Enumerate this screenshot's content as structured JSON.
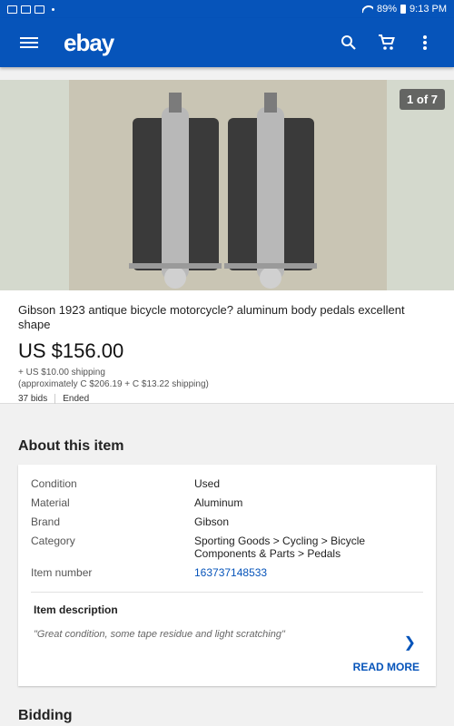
{
  "status": {
    "battery": "89%",
    "time": "9:13 PM"
  },
  "appbar": {
    "logo": "ebay"
  },
  "photo": {
    "counter": "1 of 7"
  },
  "listing": {
    "title": "Gibson 1923 antique bicycle motorcycle?  aluminum body pedals excellent shape",
    "price": "US $156.00",
    "shipping": "+ US $10.00 shipping",
    "approx": "(approximately C $206.19 + C $13.22 shipping)",
    "bids": "37 bids",
    "status": "Ended"
  },
  "about": {
    "heading": "About this item",
    "specs": [
      {
        "k": "Condition",
        "v": "Used"
      },
      {
        "k": "Material",
        "v": "Aluminum"
      },
      {
        "k": "Brand",
        "v": "Gibson"
      },
      {
        "k": "Category",
        "v": "Sporting Goods > Cycling > Bicycle Components & Parts > Pedals"
      },
      {
        "k": "Item number",
        "v": "163737148533"
      }
    ],
    "desc_title": "Item description",
    "desc": "\"Great condition, some tape residue and light scratching\"",
    "read_more": "READ MORE"
  },
  "bidding": {
    "heading": "Bidding"
  }
}
